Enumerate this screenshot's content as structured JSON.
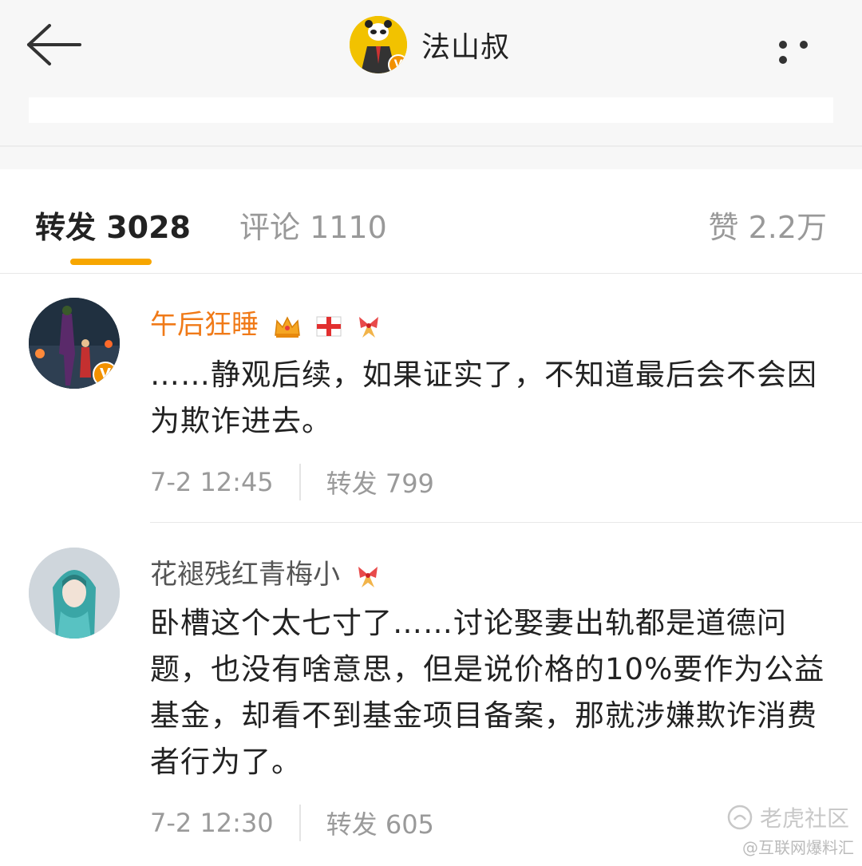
{
  "header": {
    "title": "法山叔",
    "back_icon": "back-arrow-icon",
    "more_icon": "more-dots-icon",
    "background": "#f7f7f7"
  },
  "tabs": [
    {
      "label": "转发 3028",
      "active": true
    },
    {
      "label": "评论 1110",
      "active": false
    },
    {
      "label": "赞 2.2万",
      "active": false
    }
  ],
  "accent_color": "#f7a600",
  "items": [
    {
      "name": "午后狂睡",
      "name_color": "#f07a18",
      "badges": [
        "crown-icon",
        "red-cross-flag-icon",
        "bow-icon"
      ],
      "verified": true,
      "text": "……静观后续，如果证实了，不知道最后会不会因为欺诈进去。",
      "time": "7-2 12:45",
      "repost": "转发 799"
    },
    {
      "name": "花褪残红青梅小",
      "name_color": "#555555",
      "badges": [
        "bow-icon"
      ],
      "verified": false,
      "text": "卧槽这个太七寸了……讨论娶妻出轨都是道德问题，也没有啥意思，但是说价格的10%要作为公益基金，却看不到基金项目备案，那就涉嫌欺诈消费者行为了。",
      "time": "7-2 12:30",
      "repost": "转发 605"
    }
  ],
  "watermark": {
    "line1": "老虎社区",
    "line2": "@互联网爆料汇"
  }
}
